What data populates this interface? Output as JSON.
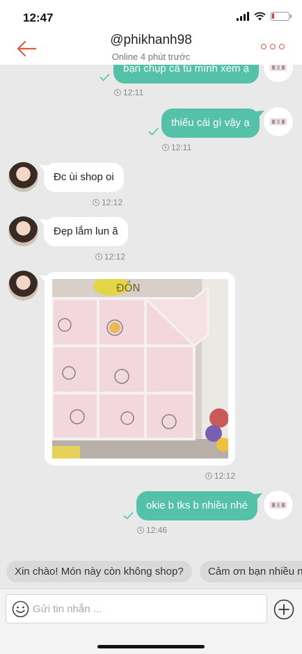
{
  "status_bar": {
    "time": "12:47",
    "battery_level": 0.12,
    "battery_color": "#e03b2e"
  },
  "header": {
    "title": "@phikhanh98",
    "subtitle": "Online 4 phút trước",
    "back_icon": "arrow-left-icon",
    "more_icon": "more-dots-icon",
    "accent": "#e35a3c"
  },
  "messages": [
    {
      "dir": "out",
      "text": "bạn chụp cả tủ mình xem ạ",
      "time": "12:11"
    },
    {
      "dir": "out",
      "text": "thiếu cái gì vậy ạ",
      "time": "12:11"
    },
    {
      "dir": "in",
      "text": "Đc ùi shop oi",
      "time": "12:12"
    },
    {
      "dir": "in",
      "text": "Đẹp lắm lun ă",
      "time": "12:12"
    },
    {
      "dir": "in",
      "type": "image",
      "time": "12:12",
      "photo_text": "ĐỒN"
    },
    {
      "dir": "out",
      "text": "okie b tks b nhiều nhé",
      "time": "12:46"
    }
  ],
  "colors": {
    "outgoing_bubble": "#54c1a8",
    "incoming_bubble": "#ffffff",
    "background": "#e9e9e9"
  },
  "quick_replies": [
    "Xin chào! Món này còn không shop?",
    "Cảm ơn bạn nhiều n"
  ],
  "composer": {
    "placeholder": "Gửi tin nhắn ...",
    "emoji_icon": "smiley-icon",
    "add_icon": "plus-circle-icon"
  }
}
